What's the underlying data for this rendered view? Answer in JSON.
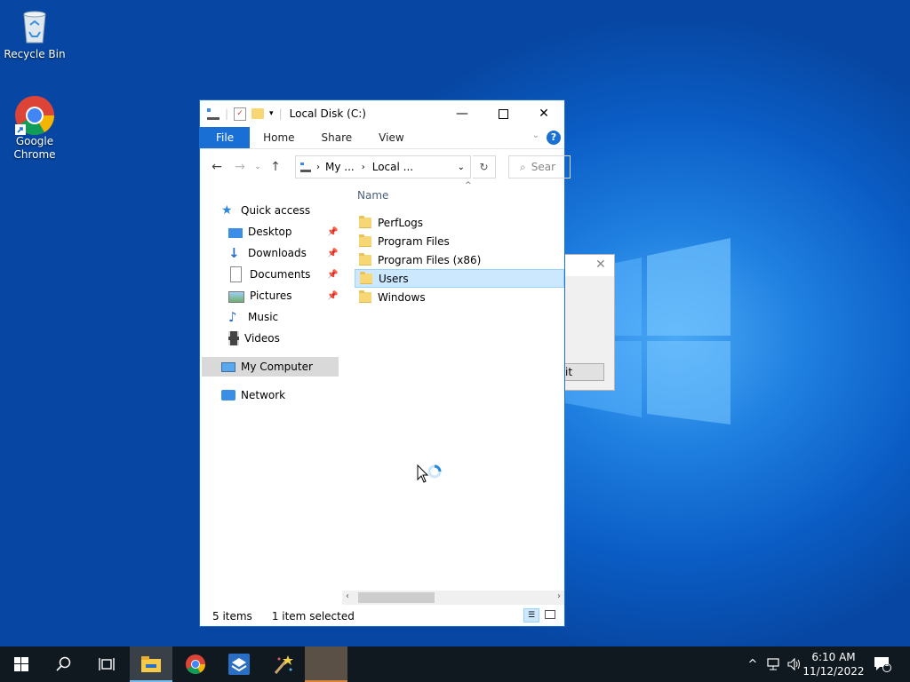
{
  "desktop": {
    "icons": [
      {
        "label": "Recycle Bin",
        "icon": "recycle-bin-icon"
      },
      {
        "label": "Google\nChrome",
        "icon": "chrome-icon"
      }
    ]
  },
  "explorer": {
    "title": "Local Disk (C:)",
    "ribbon_tabs": [
      "File",
      "Home",
      "Share",
      "View"
    ],
    "address": {
      "crumb1": "My ...",
      "crumb2": "Local ..."
    },
    "search_placeholder": "Sear",
    "nav": {
      "quick_access": "Quick access",
      "items": [
        {
          "label": "Desktop",
          "pinned": true
        },
        {
          "label": "Downloads",
          "pinned": true
        },
        {
          "label": "Documents",
          "pinned": true
        },
        {
          "label": "Pictures",
          "pinned": true
        },
        {
          "label": "Music",
          "pinned": false
        },
        {
          "label": "Videos",
          "pinned": false
        }
      ],
      "my_computer": "My Computer",
      "network": "Network"
    },
    "column_name": "Name",
    "files": [
      {
        "name": "PerfLogs",
        "selected": false
      },
      {
        "name": "Program Files",
        "selected": false
      },
      {
        "name": "Program Files (x86)",
        "selected": false
      },
      {
        "name": "Users",
        "selected": true
      },
      {
        "name": "Windows",
        "selected": false
      }
    ],
    "status": {
      "count": "5 items",
      "selection": "1 item selected"
    }
  },
  "dialog": {
    "button_label": "it"
  },
  "taskbar": {
    "apps": [
      "start-icon",
      "search-icon",
      "task-view-icon",
      "file-explorer-icon",
      "chrome-icon",
      "app-icon",
      "wizard-icon",
      "blank-app"
    ],
    "time": "6:10 AM",
    "date": "11/12/2022",
    "notification_count": "1"
  },
  "colors": {
    "accent": "#1a6fd4",
    "selection": "#cce8ff",
    "taskbar": "#101820"
  }
}
